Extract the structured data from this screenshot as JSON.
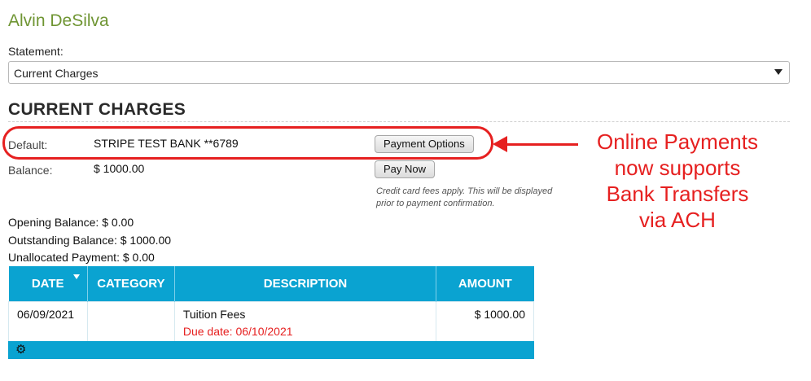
{
  "student": {
    "name": "Alvin DeSilva"
  },
  "statement": {
    "label": "Statement:",
    "selected": "Current Charges"
  },
  "section": {
    "title": "CURRENT CHARGES"
  },
  "payment": {
    "default_label": "Default:",
    "default_value": "STRIPE TEST BANK **6789",
    "options_button": "Payment Options",
    "balance_label": "Balance:",
    "balance_value": "$ 1000.00",
    "pay_now_button": "Pay Now",
    "fee_note": "Credit card fees apply. This will be displayed prior to payment confirmation."
  },
  "annotation": {
    "lines": [
      "Online Payments",
      "now supports",
      "Bank Transfers",
      "via ACH"
    ],
    "color": "#e62020"
  },
  "summary": {
    "opening": "Opening Balance: $ 0.00",
    "outstanding": "Outstanding Balance: $ 1000.00",
    "unallocated": "Unallocated Payment: $ 0.00"
  },
  "table": {
    "headers": {
      "date": "DATE",
      "category": "CATEGORY",
      "description": "DESCRIPTION",
      "amount": "AMOUNT"
    },
    "rows": [
      {
        "date": "06/09/2021",
        "category": "",
        "description": "Tuition Fees",
        "due": "Due date: 06/10/2021",
        "amount": "$ 1000.00"
      }
    ],
    "header_color": "#0aa3d1",
    "footer_icon": "gear-icon"
  },
  "colors": {
    "name": "#6f9533",
    "accent": "#0aa3d1",
    "alert": "#e62020"
  }
}
